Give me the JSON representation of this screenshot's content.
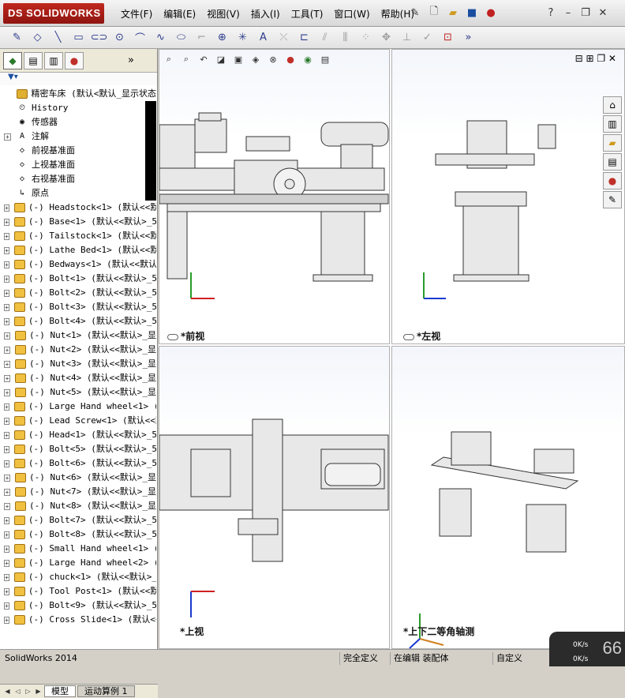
{
  "app": {
    "logo_text": "DS SOLIDWORKS",
    "brand_color": "#b3241a"
  },
  "menu": [
    "文件(F)",
    "编辑(E)",
    "视图(V)",
    "插入(I)",
    "工具(T)",
    "窗口(W)",
    "帮助(H)"
  ],
  "tree": {
    "root": "精密车床   (默认<默认_显示状态",
    "fixed": [
      {
        "label": "History",
        "icon": "history-icon"
      },
      {
        "label": "传感器",
        "icon": "sensor-icon"
      },
      {
        "label": "注解",
        "icon": "annotation-icon"
      },
      {
        "label": "前视基准面",
        "icon": "plane-icon"
      },
      {
        "label": "上视基准面",
        "icon": "plane-icon"
      },
      {
        "label": "右视基准面",
        "icon": "plane-icon"
      },
      {
        "label": "原点",
        "icon": "origin-icon"
      }
    ],
    "parts": [
      "(-) Headstock<1> (默认<<默认",
      "(-) Base<1> (默认<<默认>_5",
      "(-) Tailstock<1> (默认<<默认",
      "(-) Lathe Bed<1> (默认<<默认",
      "(-) Bedways<1> (默认<<默认",
      "(-) Bolt<1> (默认<<默认>_5",
      "(-) Bolt<2> (默认<<默认>_5",
      "(-) Bolt<3> (默认<<默认>_5",
      "(-) Bolt<4> (默认<<默认>_5",
      "(-) Nut<1> (默认<<默认>_显",
      "(-) Nut<2> (默认<<默认>_显",
      "(-) Nut<3> (默认<<默认>_显",
      "(-) Nut<4> (默认<<默认>_显",
      "(-) Nut<5> (默认<<默认>_显",
      "(-) Large Hand wheel<1> (默",
      "(-) Lead Screw<1> (默认<<默",
      "(-) Head<1> (默认<<默认>_5",
      "(-) Bolt<5> (默认<<默认>_5",
      "(-) Bolt<6> (默认<<默认>_5",
      "(-) Nut<6> (默认<<默认>_显",
      "(-) Nut<7> (默认<<默认>_显",
      "(-) Nut<8> (默认<<默认>_显",
      "(-) Bolt<7> (默认<<默认>_5",
      "(-) Bolt<8> (默认<<默认>_5",
      "(-) Small Hand wheel<1> (默",
      "(-) Large Hand wheel<2> (默",
      "(-) chuck<1> (默认<<默认>_",
      "(-) Tool Post<1> (默认<<默认",
      "(-) Bolt<9> (默认<<默认>_5",
      "(-) Cross Slide<1> (默认<<"
    ]
  },
  "bottom_tabs": [
    "模型",
    "运动算例 1"
  ],
  "viewports": {
    "front": "*前视",
    "left": "*左视",
    "top": "*上视",
    "iso": "*上下二等角轴测"
  },
  "status": {
    "app": "SolidWorks 2014",
    "defined": "完全定义",
    "editing": "在编辑 装配体",
    "custom": "自定义"
  },
  "net": {
    "up": "0K/s",
    "down": "0K/s",
    "percent": "66"
  }
}
